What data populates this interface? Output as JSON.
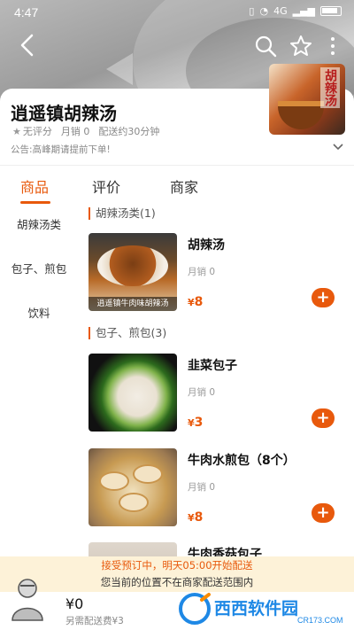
{
  "status_bar": {
    "time": "4:47",
    "signal_text": "4G"
  },
  "shop": {
    "name": "逍遥镇胡辣汤",
    "rating": "无评分",
    "monthly_sales": "月销 0",
    "delivery": "配送约30分钟",
    "notice": "公告:高峰期请提前下单!",
    "logo_text": "胡辣汤"
  },
  "tabs": [
    "商品",
    "评价",
    "商家"
  ],
  "categories": [
    "胡辣汤类",
    "包子、煎包",
    "饮料"
  ],
  "sections": [
    {
      "title": "胡辣汤类(1)",
      "items": [
        {
          "name": "胡辣汤",
          "sales": "月销 0",
          "price": "8",
          "currency": "¥",
          "image_caption": "逍遥镇牛肉味胡辣汤"
        }
      ]
    },
    {
      "title": "包子、煎包(3)",
      "items": [
        {
          "name": "韭菜包子",
          "sales": "月销 0",
          "price": "3",
          "currency": "¥"
        },
        {
          "name": "牛肉水煎包（8个）",
          "sales": "月销 0",
          "price": "8",
          "currency": "¥"
        },
        {
          "name": "牛肉香菇包子"
        }
      ]
    }
  ],
  "bottom": {
    "preorder_banner": "接受预订中，明天05:00开始配送",
    "location_banner": "您当前的位置不在商家配送范围内",
    "total": "¥0",
    "delivery_fee": "另需配送费¥3"
  },
  "watermark": {
    "brand": "西西软件园",
    "domain": "CR173.COM"
  },
  "colors": {
    "accent": "#e8590c",
    "banner_bg": "#fdf2d8"
  },
  "icons": [
    "back-icon",
    "search-icon",
    "star-icon",
    "more-icon",
    "chevron-down-icon",
    "add-icon"
  ]
}
